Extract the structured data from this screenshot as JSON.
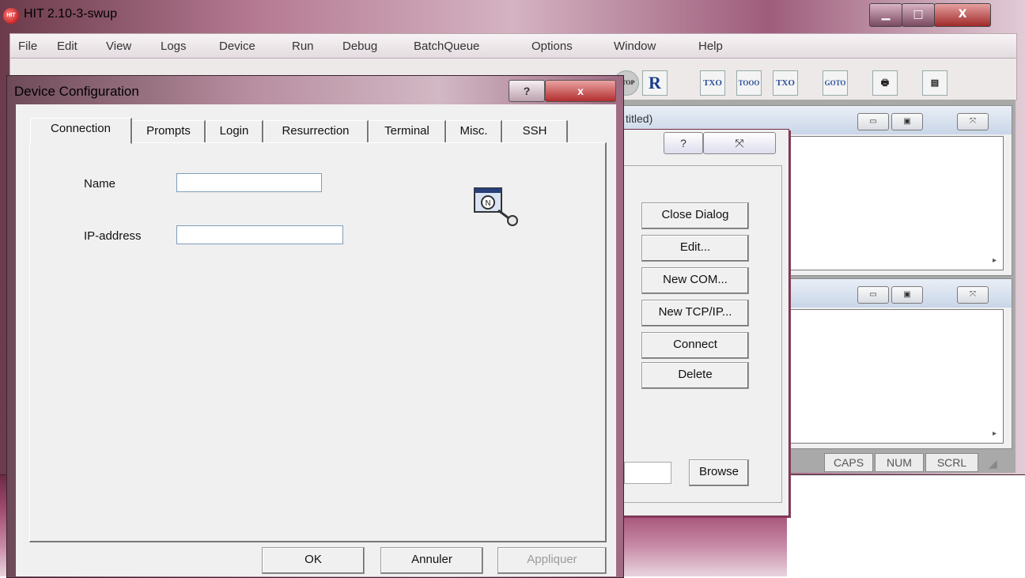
{
  "app": {
    "title": "HIT 2.10-3-swup",
    "icon_text": "HIT",
    "min_glyph": "▁",
    "max_glyph": "□",
    "close_glyph": "X"
  },
  "menu": [
    "File",
    "Edit",
    "View",
    "Logs",
    "Device",
    "Run",
    "Debug",
    "BatchQueue",
    "Options",
    "Window",
    "Help"
  ],
  "toolbar_icons": [
    "stop-icon",
    "r-icon",
    "step-icon",
    "step-many-icon",
    "return-icon",
    "goto-icon",
    "print-icon",
    "report-icon"
  ],
  "toolbar_labels": {
    "stop": "STOP",
    "r": "R",
    "txo": "TXO",
    "too": "TOOO",
    "goto": "GOTO"
  },
  "mdi": {
    "top_title": "titled)",
    "min_glyph": "▭",
    "max_glyph": "▣",
    "close_glyph": "⤧",
    "scroll_arrow": "▸"
  },
  "status": {
    "caps": "CAPS",
    "num": "NUM",
    "scrl": "SCRL"
  },
  "device_list_dialog": {
    "help": "?",
    "close": "⤧",
    "buttons": [
      "Close Dialog",
      "Edit...",
      "New COM...",
      "New TCP/IP...",
      "Connect",
      "Delete"
    ],
    "browse": "Browse"
  },
  "device_config": {
    "title": "Device Configuration",
    "help": "?",
    "close": "x",
    "tabs": [
      "Connection",
      "Prompts",
      "Login",
      "Resurrection",
      "Terminal",
      "Misc.",
      "SSH"
    ],
    "name_label": "Name",
    "name_value": "",
    "ip_label": "IP-address",
    "ip_value": "",
    "ok": "OK",
    "cancel": "Annuler",
    "apply": "Appliquer"
  },
  "colors": {
    "accent_close": "#b22e2e",
    "field_border": "#7f9db9",
    "dialog_face": "#f0f0f0"
  }
}
